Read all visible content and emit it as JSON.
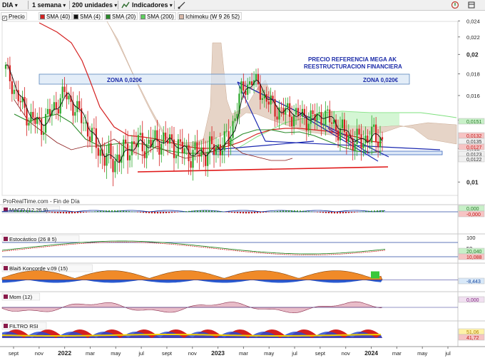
{
  "toolbar": {
    "symbol": "DIA",
    "timeframe": "1 semana",
    "units": "200 unidades",
    "indicators": "Indicadores"
  },
  "legend": [
    {
      "label": "Precio",
      "color": "#ffffff"
    },
    {
      "label": "SMA (40)",
      "color": "#d42020"
    },
    {
      "label": "SMA (4)",
      "color": "#111111"
    },
    {
      "label": "SMA (20)",
      "color": "#2a8a2a"
    },
    {
      "label": "SMA (200)",
      "color": "#5fd05f"
    },
    {
      "label": "Ichimoku (W 9 26 52)",
      "color": "#d8b8a8"
    }
  ],
  "chart_data": [
    {
      "type": "line",
      "title": "",
      "y_axis_scale": "log",
      "yticks": [
        "0,024",
        "0,022",
        "0,02",
        "0,018",
        "0,016",
        "0,014",
        "0,012",
        "0,01"
      ],
      "price_tags": [
        "0,0151",
        "0,0132",
        "0,0135",
        "0,0127",
        "0,0123",
        "0,0122"
      ],
      "annotations": [
        "PRECIO REFERENCIA MEGA AK",
        "REESTRUCTURACION FINANCIERA"
      ],
      "zone_left_label": "ZONA 0,020€",
      "zone_right_label": "ZONA 0,020€",
      "source": "ProRealTime.com - Fin de Día",
      "series": [
        {
          "values": [
            0.0185,
            0.0158,
            0.0142,
            0.0136,
            0.0148,
            0.0162,
            0.0148,
            0.0133,
            0.0118,
            0.0112,
            0.0117,
            0.0124,
            0.0122,
            0.0126,
            0.0124,
            0.0119,
            0.0116,
            0.0118,
            0.0121,
            0.0126,
            0.0163,
            0.0175,
            0.0158,
            0.0148,
            0.0146,
            0.0143,
            0.0141,
            0.0144,
            0.0136,
            0.0128,
            0.0124,
            0.0129,
            0.0126
          ]
        }
      ]
    },
    {
      "type": "area",
      "title": "MACD (12 26 9)",
      "price_tags": [
        "0,000",
        "-0,000"
      ]
    },
    {
      "type": "line",
      "title": "Estocástico (26 8 5)",
      "yticks": [
        "100",
        "50",
        "0"
      ],
      "price_tags": [
        "20,040",
        "10,088"
      ]
    },
    {
      "type": "area",
      "title": "Blai5 Koncorde v.09 (15)",
      "price_tags": [
        "-8,443"
      ]
    },
    {
      "type": "area",
      "title": "Mom (12)",
      "price_tags": [
        "0,000"
      ]
    },
    {
      "type": "area",
      "title": "FILTRO RSI",
      "price_tags": [
        "51,06",
        "41,72"
      ]
    }
  ],
  "x_axis": [
    "sept",
    "nov",
    "2022",
    "mar",
    "may",
    "jul",
    "sept",
    "nov",
    "2023",
    "mar",
    "may",
    "jul",
    "sept",
    "nov",
    "2024",
    "mar",
    "may",
    "jul"
  ]
}
